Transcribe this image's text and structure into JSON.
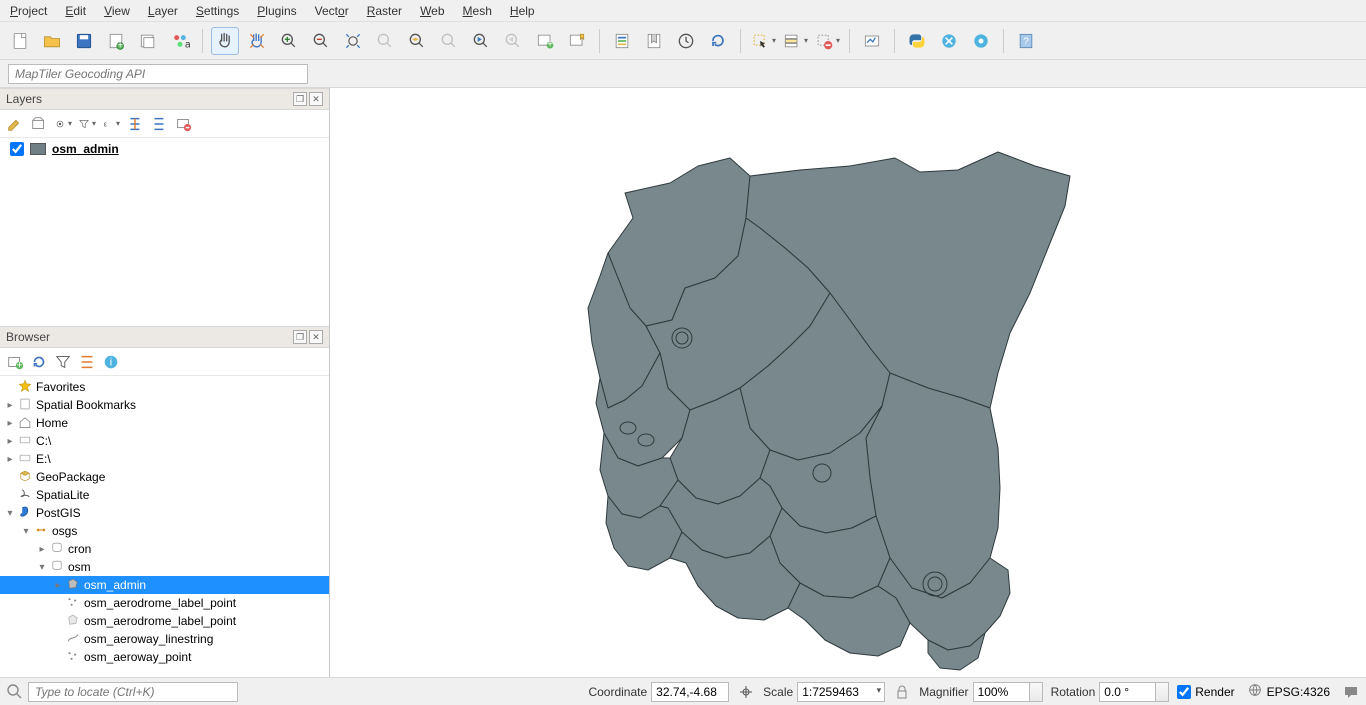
{
  "menu": [
    "Project",
    "Edit",
    "View",
    "Layer",
    "Settings",
    "Plugins",
    "Vector",
    "Raster",
    "Web",
    "Mesh",
    "Help"
  ],
  "search": {
    "placeholder": "MapTiler Geocoding API"
  },
  "panels": {
    "layers": {
      "title": "Layers",
      "layer": {
        "name": "osm_admin",
        "checked": true
      }
    },
    "browser": {
      "title": "Browser",
      "tree": [
        {
          "indent": 0,
          "exp": "",
          "icon": "star",
          "label": "Favorites",
          "color": "#f4c20d"
        },
        {
          "indent": 0,
          "exp": "▸",
          "icon": "bookmark",
          "label": "Spatial Bookmarks"
        },
        {
          "indent": 0,
          "exp": "▸",
          "icon": "home",
          "label": "Home"
        },
        {
          "indent": 0,
          "exp": "▸",
          "icon": "drive",
          "label": "C:\\"
        },
        {
          "indent": 0,
          "exp": "▸",
          "icon": "drive",
          "label": "E:\\"
        },
        {
          "indent": 0,
          "exp": "",
          "icon": "geopackage",
          "label": "GeoPackage",
          "color": "#c89b3c"
        },
        {
          "indent": 0,
          "exp": "",
          "icon": "spatialite",
          "label": "SpatiaLite"
        },
        {
          "indent": 0,
          "exp": "▾",
          "icon": "postgis",
          "label": "PostGIS",
          "color": "#2e7bd6"
        },
        {
          "indent": 1,
          "exp": "▾",
          "icon": "conn",
          "label": "osgs",
          "color": "#d98c2b"
        },
        {
          "indent": 2,
          "exp": "▸",
          "icon": "schema",
          "label": "cron"
        },
        {
          "indent": 2,
          "exp": "▾",
          "icon": "schema",
          "label": "osm"
        },
        {
          "indent": 3,
          "exp": "▸",
          "icon": "polygon",
          "label": "osm_admin",
          "sel": true
        },
        {
          "indent": 3,
          "exp": "",
          "icon": "point",
          "label": "osm_aerodrome_label_point"
        },
        {
          "indent": 3,
          "exp": "",
          "icon": "polygon-l",
          "label": "osm_aerodrome_label_point"
        },
        {
          "indent": 3,
          "exp": "",
          "icon": "line",
          "label": "osm_aeroway_linestring"
        },
        {
          "indent": 3,
          "exp": "",
          "icon": "point",
          "label": "osm_aeroway_point"
        }
      ]
    }
  },
  "status": {
    "locator_placeholder": "Type to locate (Ctrl+K)",
    "coordinate_label": "Coordinate",
    "coordinate": "32.74,-4.68",
    "scale_label": "Scale",
    "scale": "1:7259463",
    "magnifier_label": "Magnifier",
    "magnifier": "100%",
    "rotation_label": "Rotation",
    "rotation": "0.0 °",
    "render_label": "Render",
    "render_checked": true,
    "crs": "EPSG:4326"
  }
}
